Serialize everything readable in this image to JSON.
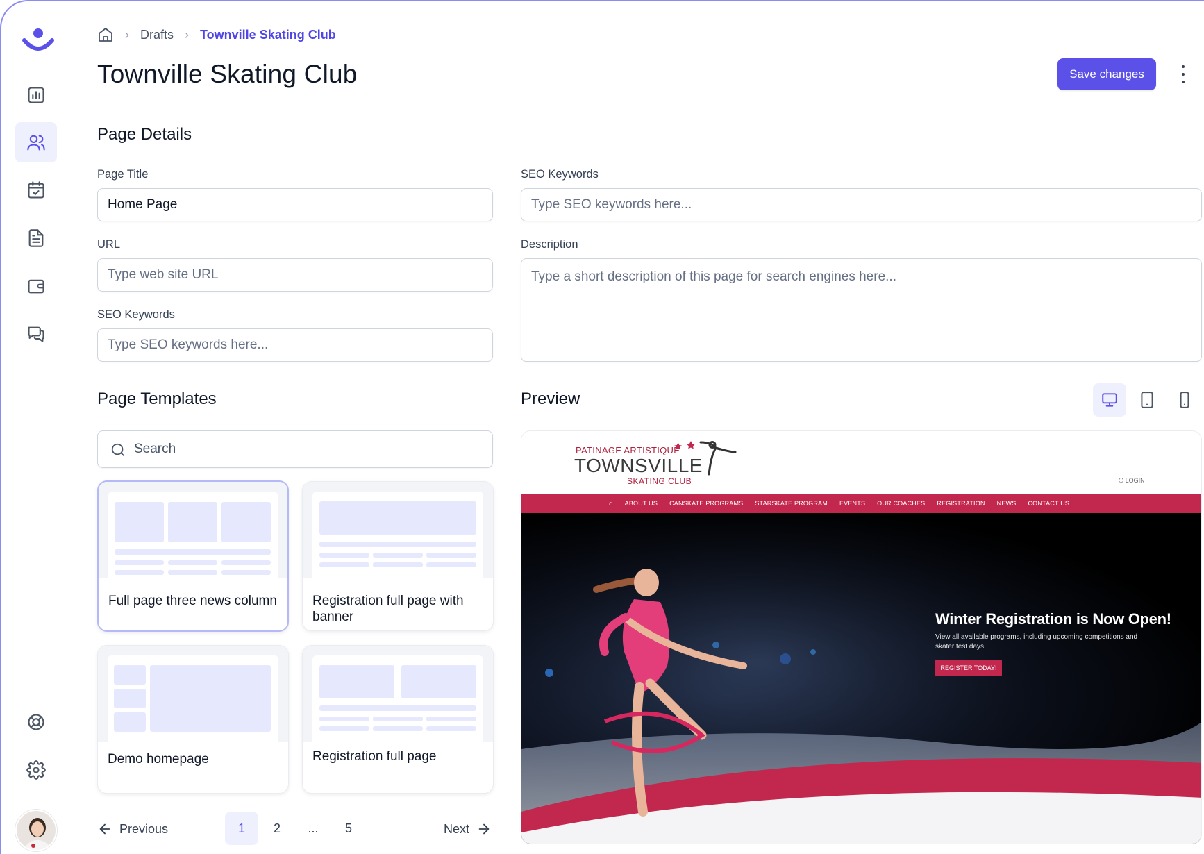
{
  "breadcrumb": {
    "items": [
      "Drafts",
      "Townville Skating Club"
    ]
  },
  "page": {
    "title": "Townville Skating Club"
  },
  "header": {
    "save_label": "Save changes"
  },
  "page_details": {
    "title": "Page Details",
    "page_title_label": "Page Title",
    "page_title_value": "Home Page",
    "url_label": "URL",
    "url_placeholder": "Type web site URL",
    "seo_left_label": "SEO Keywords",
    "seo_left_placeholder": "Type SEO keywords here...",
    "seo_right_label": "SEO Keywords",
    "seo_right_placeholder": "Type SEO keywords here...",
    "description_label": "Description",
    "description_placeholder": "Type a short description of this page for search engines here..."
  },
  "templates": {
    "title": "Page Templates",
    "search_placeholder": "Search",
    "cards": [
      {
        "label": "Full page three news column",
        "selected": true
      },
      {
        "label": "Registration full page with banner",
        "selected": false
      },
      {
        "label": "Demo homepage",
        "selected": false
      },
      {
        "label": "Registration full page",
        "selected": false
      }
    ]
  },
  "pagination": {
    "prev": "Previous",
    "next": "Next",
    "pages": [
      "1",
      "2",
      "...",
      "5"
    ],
    "current": "1"
  },
  "preview": {
    "title": "Preview",
    "devices": [
      "desktop-icon",
      "tablet-icon",
      "mobile-icon"
    ],
    "active_device": "desktop",
    "site": {
      "brand_top": "PATINAGE ARTISTIQUE",
      "brand_main": "TOWNSVILLE",
      "brand_sub": "SKATING CLUB",
      "login": "LOGIN",
      "nav": [
        "ABOUT US",
        "CANSKATE PROGRAMS",
        "STARSKATE PROGRAM",
        "EVENTS",
        "OUR COACHES",
        "REGISTRATION",
        "NEWS",
        "CONTACT US"
      ],
      "hero_title": "Winter Registration is Now Open!",
      "hero_text": "View all available programs, including upcoming competitions and skater test days.",
      "hero_button": "REGISTER TODAY!"
    }
  },
  "colors": {
    "accent": "#5b50e8",
    "accent_light": "#eef0fe",
    "site_brand": "#c2274e"
  }
}
